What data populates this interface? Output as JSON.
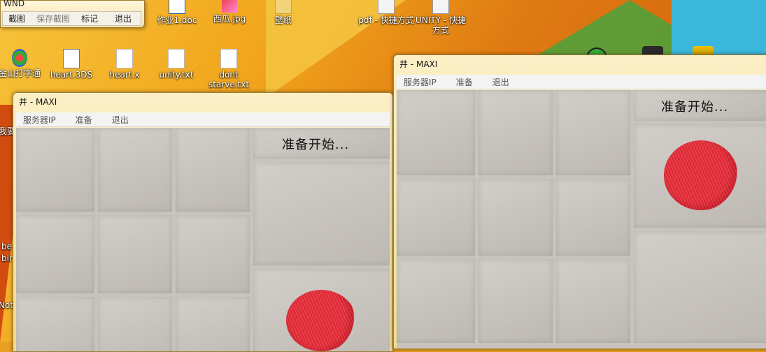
{
  "desktop": {
    "icons": [
      {
        "label": "作业1.doc",
        "icon": "word-doc-icon"
      },
      {
        "label": "西瓜.jpg",
        "icon": "image-file-icon"
      },
      {
        "label": "壁纸",
        "icon": "folder-icon"
      },
      {
        "label": "pdf - 快捷方式",
        "icon": "shortcut-icon"
      },
      {
        "label": "UNITY - 快捷方式",
        "icon": "shortcut-icon"
      },
      {
        "label": "金山打字通",
        "icon": "app-icon"
      },
      {
        "label": "heart.3DS",
        "icon": "3ds-file-icon"
      },
      {
        "label": "heart.x",
        "icon": "file-icon"
      },
      {
        "label": "unity.txt",
        "icon": "text-file-icon"
      },
      {
        "label": "dont starve.txt",
        "icon": "text-file-icon"
      }
    ],
    "edge_labels": [
      "我要",
      "be",
      "bir",
      "Note"
    ]
  },
  "wnd": {
    "title": "WND",
    "menu": [
      "截图",
      "保存截图",
      "标记",
      "退出"
    ]
  },
  "window_left": {
    "title": "井 - MAXI",
    "menu": [
      "服务器IP",
      "准备",
      "退出"
    ],
    "status": "准备开始..."
  },
  "window_right": {
    "title": "井 - MAXI",
    "menu": [
      "服务器IP",
      "准备",
      "退出"
    ],
    "status": "准备开始..."
  },
  "colors": {
    "marker": "#d8262f",
    "window_frame": "#f1d98e"
  }
}
